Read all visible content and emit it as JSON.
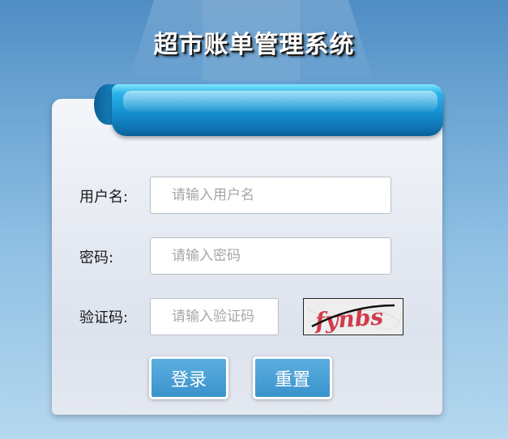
{
  "page": {
    "title": "超市账单管理系统"
  },
  "form": {
    "username_label": "用户名:",
    "username_placeholder": "请输入用户名",
    "password_label": "密码:",
    "password_placeholder": "请输入密码",
    "captcha_label": "验证码:",
    "captcha_placeholder": "请输入验证码",
    "captcha_text": "fynbs"
  },
  "buttons": {
    "login": "登录",
    "reset": "重置"
  },
  "colors": {
    "accent": "#3a93cc",
    "ribbon": "#168fce",
    "title_text": "#ffffff"
  }
}
